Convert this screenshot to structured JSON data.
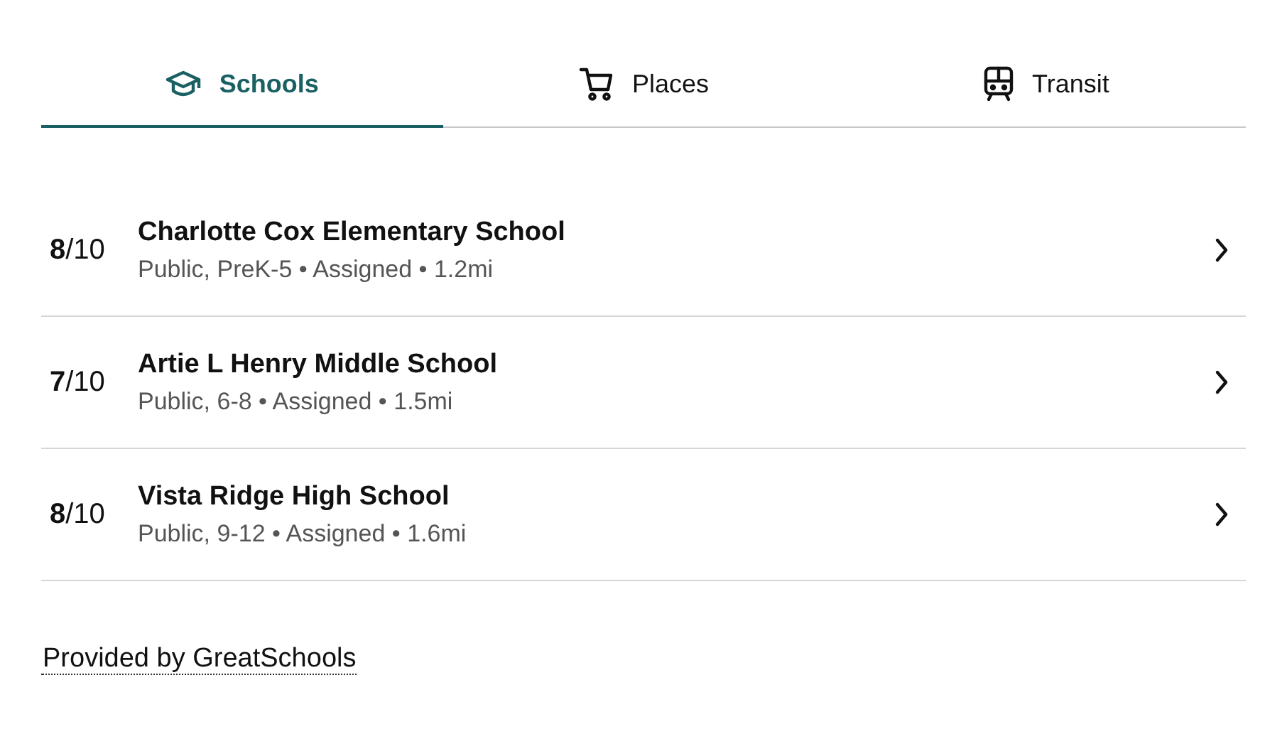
{
  "tabs": [
    {
      "label": "Schools",
      "selected": true
    },
    {
      "label": "Places",
      "selected": false
    },
    {
      "label": "Transit",
      "selected": false
    }
  ],
  "schools": [
    {
      "rating": "**8**/10",
      "name": "Charlotte Cox Elementary School",
      "details": "Public, PreK-5 • Assigned • 1.2mi"
    },
    {
      "rating": "**7**/10",
      "name": "Artie L Henry Middle School",
      "details": "Public, 6-8 • Assigned • 1.5mi"
    },
    {
      "rating": "**8**/10",
      "name": "Vista Ridge High School",
      "details": "Public, 9-12 • Assigned • 1.6mi"
    }
  ],
  "footer_link": "Provided by GreatSchools"
}
